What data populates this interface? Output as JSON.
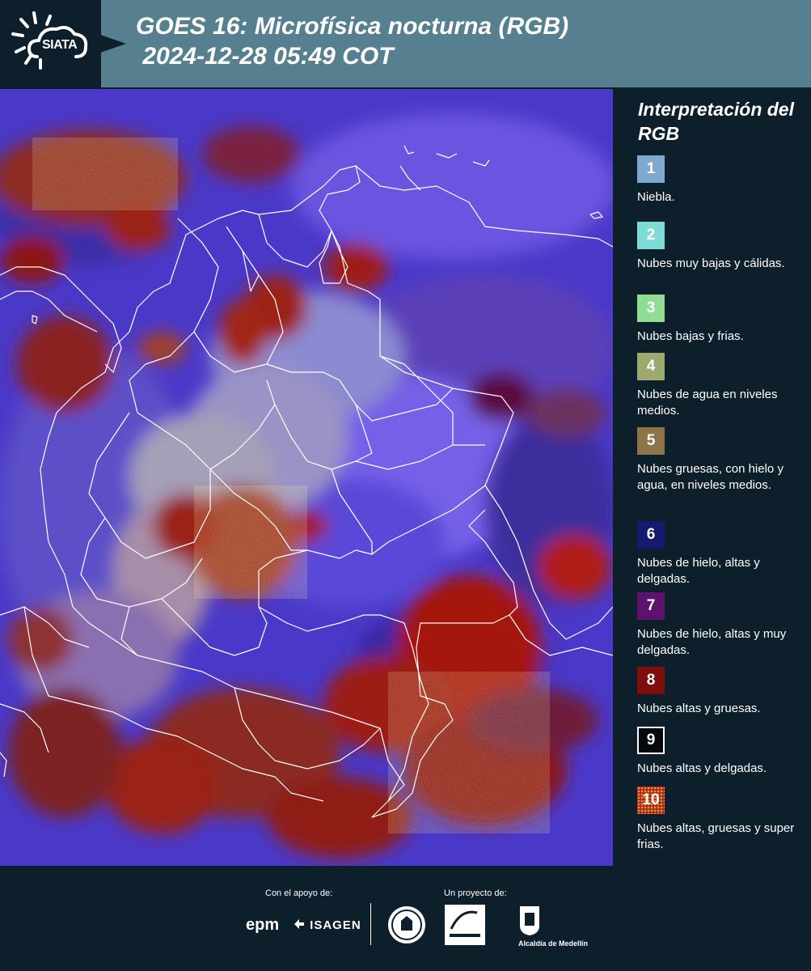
{
  "header": {
    "logo_text": "SIATA",
    "title_line1": "GOES 16: Microfísica nocturna (RGB)",
    "title_line2": " 2024-12-28 05:49 COT"
  },
  "legend": {
    "title": "Interpretación del RGB",
    "items": [
      {
        "num": "1",
        "label": "Niebla.",
        "color": "#7fa8cf"
      },
      {
        "num": "2",
        "label": "Nubes muy bajas y cálidas.",
        "color": "#7edbd6"
      },
      {
        "num": "3",
        "label": "Nubes bajas y frias.",
        "color": "#8fdc94"
      },
      {
        "num": "4",
        "label": "Nubes de agua en niveles medios.",
        "color": "#9ca96f"
      },
      {
        "num": "5",
        "label": "Nubes gruesas, con hielo y agua, en niveles medios.",
        "color": "#8e744a"
      },
      {
        "num": "6",
        "label": "Nubes de hielo, altas y delgadas.",
        "color": "#141a6e"
      },
      {
        "num": "7",
        "label": "Nubes de hielo, altas y muy delgadas.",
        "color": "#5b136e"
      },
      {
        "num": "8",
        "label": "Nubes altas y gruesas.",
        "color": "#7d0e0e"
      },
      {
        "num": "9",
        "label": "Nubes altas y delgadas.",
        "color": "#05080d"
      },
      {
        "num": "10",
        "label": "Nubes altas, gruesas y super frias.",
        "color": "#b02a1a"
      }
    ]
  },
  "footer": {
    "support_label": "Con el apoyo de:",
    "project_label": "Un proyecto de:",
    "sponsor_epm": "epm",
    "sponsor_isagen": "ISAGEN",
    "alcaldia_label": "Alcaldía de Medellín"
  }
}
